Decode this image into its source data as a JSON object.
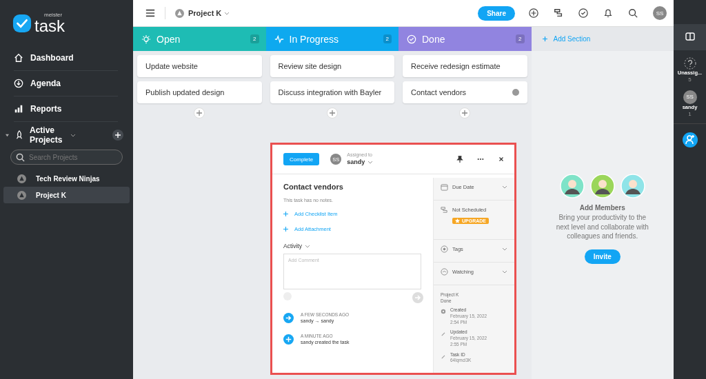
{
  "brand": {
    "small": "meister",
    "name": "task"
  },
  "nav": [
    {
      "label": "Dashboard",
      "kind": "home"
    },
    {
      "label": "Agenda",
      "kind": "agenda"
    },
    {
      "label": "Reports",
      "kind": "reports"
    }
  ],
  "projects_group": {
    "label": "Active Projects",
    "expanded": true,
    "search": {
      "placeholder": "Search Projects"
    },
    "items": [
      {
        "label": "Tech Review Ninjas",
        "selected": false
      },
      {
        "label": "Project K",
        "selected": true
      }
    ]
  },
  "topbar": {
    "project": "Project K",
    "share": "Share",
    "avatar": "SS"
  },
  "sections": [
    {
      "title": "Open",
      "count": "2",
      "kind": "bulb",
      "color": "#1ebcb4",
      "tasks": [
        {
          "title": "Update website",
          "indicator": false
        },
        {
          "title": "Publish updated design",
          "indicator": false
        }
      ]
    },
    {
      "title": "In Progress",
      "count": "2",
      "kind": "pulse",
      "color": "#0ea9ef",
      "tasks": [
        {
          "title": "Review site design",
          "indicator": false
        },
        {
          "title": "Discuss integration with Bayler",
          "indicator": false
        }
      ]
    },
    {
      "title": "Done",
      "count": "2",
      "kind": "check",
      "color": "#9184e0",
      "tasks": [
        {
          "title": "Receive redesign estimate",
          "indicator": false
        },
        {
          "title": "Contact vendors",
          "indicator": true
        }
      ]
    }
  ],
  "add_section": "Add Section",
  "members_panel": {
    "title": "Add Members",
    "text": "Bring your productivity to the next level and collaborate with colleagues and friends.",
    "button": "Invite",
    "avatars": [
      {
        "color": "#7fe3c8"
      },
      {
        "color": "#9bd65a"
      },
      {
        "color": "#8fe4e8"
      }
    ]
  },
  "rail": [
    {
      "kind": "unassigned",
      "name": "Unassig...",
      "count": "5"
    },
    {
      "kind": "user",
      "initials": "SS",
      "name": "sandy",
      "count": "1"
    }
  ],
  "task": {
    "complete": "Complete",
    "assigned_label": "Assigned to",
    "assignee": "sandy",
    "initials": "SS",
    "title": "Contact vendors",
    "notes": "This task has no notes.",
    "actions": [
      "Add Checklist Item",
      "Add Attachment"
    ],
    "activity_label": "Activity",
    "comment_placeholder": "Add Comment",
    "activity": [
      {
        "kind": "move",
        "time": "A FEW SECONDS AGO",
        "text": "sandy → sandy"
      },
      {
        "kind": "create",
        "time": "A MINUTE AGO",
        "text": "sandy created the task"
      }
    ],
    "fields": [
      {
        "kind": "date",
        "label": "Due Date"
      },
      {
        "kind": "schedule",
        "label": "Not Scheduled",
        "badge": "UPGRADE"
      },
      {
        "kind": "tags",
        "label": "Tags"
      },
      {
        "kind": "watch",
        "label": "Watching"
      }
    ],
    "project": "Project K",
    "section": "Done",
    "info": [
      {
        "kind": "created",
        "label": "Created",
        "lines": [
          "February 15, 2022",
          "2:54 PM"
        ]
      },
      {
        "kind": "edit",
        "label": "Updated",
        "lines": [
          "February 15, 2022",
          "2:55 PM"
        ]
      },
      {
        "kind": "edit",
        "label": "Task ID",
        "lines": [
          "64lqmcl3K"
        ]
      }
    ]
  }
}
